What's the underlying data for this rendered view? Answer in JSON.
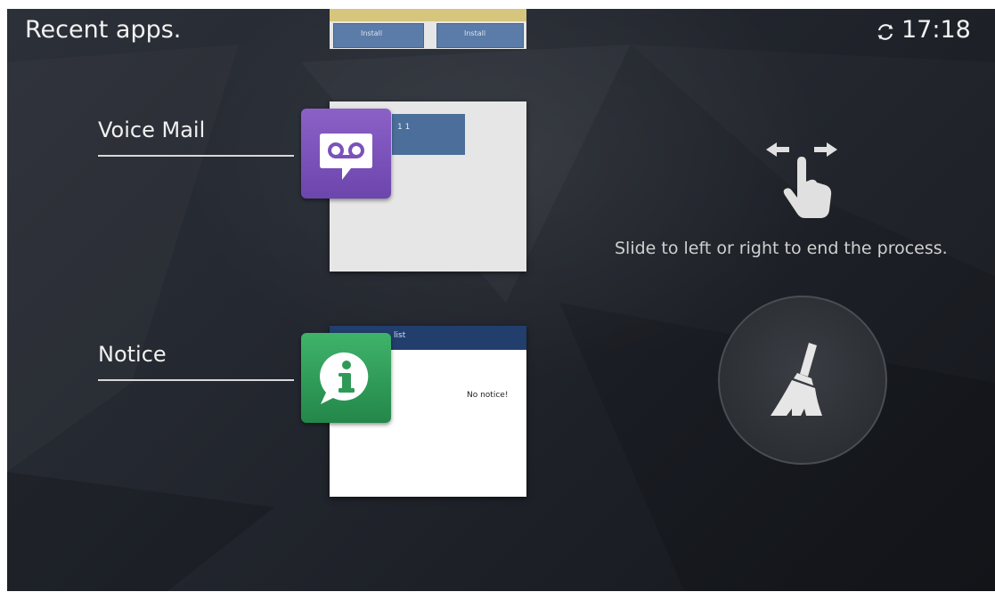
{
  "status_bar": {
    "title": "Recent apps.",
    "clock": "17:18",
    "sync_icon": "sync-icon"
  },
  "peek_card": {
    "button_left_label": "Install",
    "button_right_label": "Install"
  },
  "recent_apps": [
    {
      "name": "Voice Mail",
      "icon": "voicemail-icon",
      "icon_color": "#7a52b9",
      "thumbnail_text": "1 1"
    },
    {
      "name": "Notice",
      "icon": "info-icon",
      "icon_color": "#2f9a58",
      "thumbnail_header": "list",
      "thumbnail_body": "No notice!"
    }
  ],
  "hint": {
    "text": "Slide to left or right to end the process.",
    "icon": "swipe-gesture-icon"
  },
  "clear_all": {
    "icon": "broom-icon"
  }
}
